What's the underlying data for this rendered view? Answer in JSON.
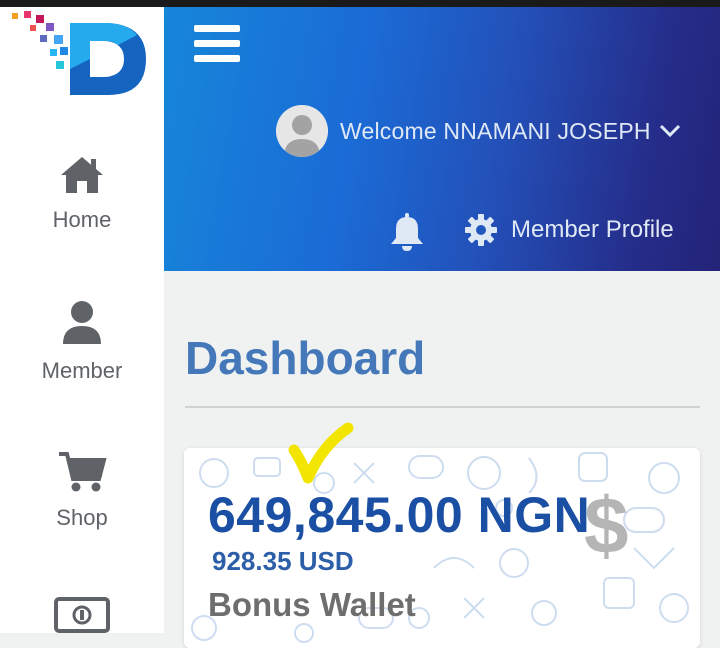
{
  "sidebar": {
    "items": [
      {
        "label": "Home",
        "icon": "home-icon"
      },
      {
        "label": "Member",
        "icon": "user-icon"
      },
      {
        "label": "Shop",
        "icon": "cart-icon"
      },
      {
        "label": "",
        "icon": "money-bill-icon"
      }
    ]
  },
  "header": {
    "welcome": "Welcome NNAMANI JOSEPH",
    "profile_label": "Member Profile"
  },
  "main": {
    "title": "Dashboard",
    "wallet": {
      "amount": "649,845.00 NGN",
      "usd": "928.35 USD",
      "label": "Bonus Wallet"
    }
  },
  "colors": {
    "header_start": "#1686d9",
    "header_end": "#242378",
    "title": "#4478b8",
    "amount": "#1a4fa3",
    "check_mark": "#f2e600"
  }
}
